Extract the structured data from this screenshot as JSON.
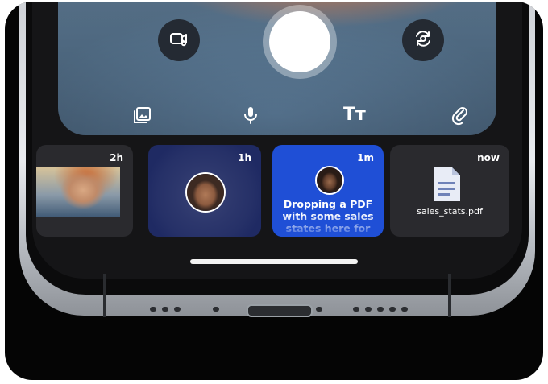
{
  "viewfinder": {
    "buttons": {
      "left": "video-settings-icon",
      "shutter": "shutter-button",
      "right": "flip-camera-icon"
    },
    "toolbar": {
      "gallery": "gallery-icon",
      "microphone": "microphone-icon",
      "text_label": "Tт",
      "attachment": "paperclip-icon"
    }
  },
  "recents": [
    {
      "time": "2h",
      "kind": "photo"
    },
    {
      "time": "1h",
      "kind": "audio"
    },
    {
      "time": "1m",
      "kind": "message",
      "message": "Dropping a PDF with some sales states here for"
    },
    {
      "time": "now",
      "kind": "file",
      "file_name": "sales_stats.pdf"
    }
  ],
  "colors": {
    "card_dark": "#2a2a2e",
    "card_navy": "#1f2a63",
    "card_blue": "#1f4fd6",
    "shutter": "#ffffff"
  }
}
